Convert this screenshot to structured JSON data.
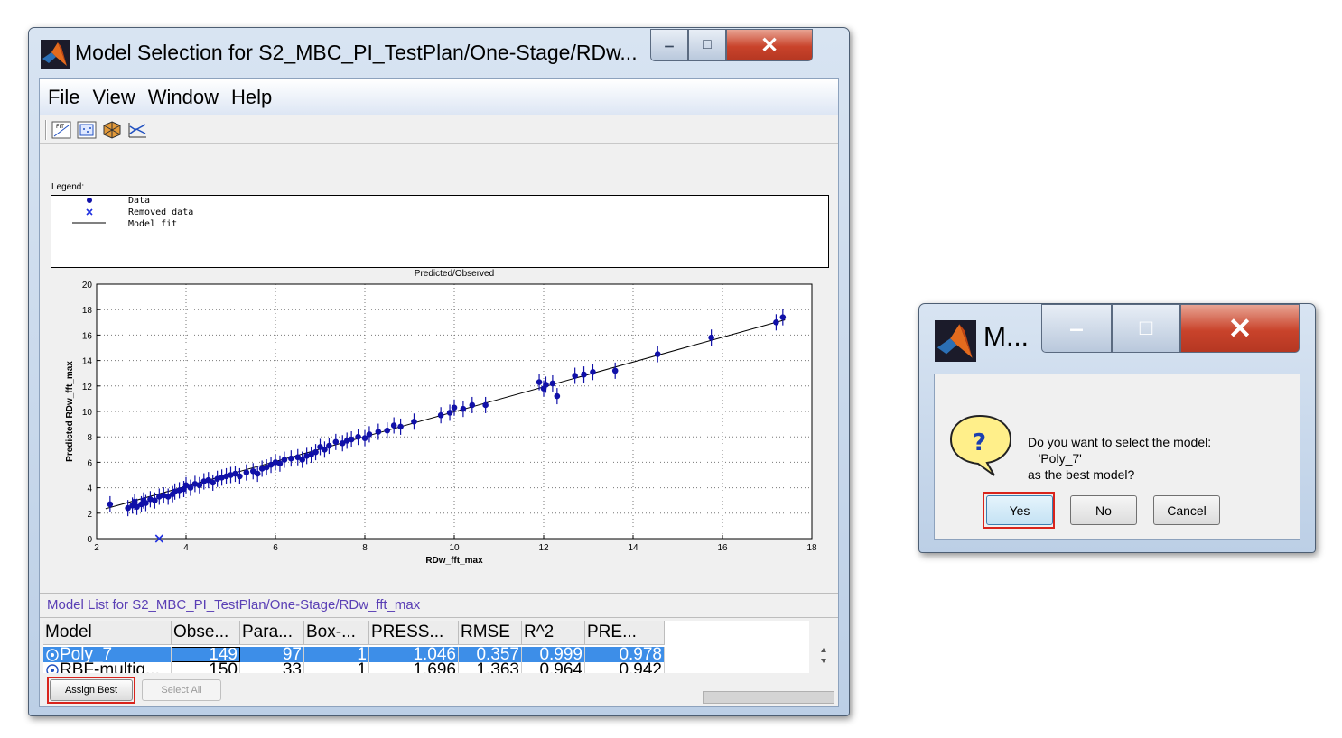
{
  "main_window": {
    "title": "Model Selection for S2_MBC_PI_TestPlan/One-Stage/RDw...",
    "menu": [
      "File",
      "View",
      "Window",
      "Help"
    ],
    "toolbar_icons": [
      "fit-plot-icon",
      "residual-plot-icon",
      "cube-3d-icon",
      "cross-section-plot-icon"
    ],
    "legend": {
      "label": "Legend:",
      "entries": [
        "Data",
        "Removed data",
        "Model fit"
      ]
    },
    "model_list_title": "Model List for S2_MBC_PI_TestPlan/One-Stage/RDw_fft_max",
    "table": {
      "columns": [
        "Model",
        "Obse...",
        "Para...",
        "Box-...",
        "PRESS...",
        "RMSE",
        "R^2",
        "PRE..."
      ],
      "rows": [
        [
          "Poly_7",
          "149",
          "97",
          "1",
          "1.046",
          "0.357",
          "0.999",
          "0.978"
        ],
        [
          "RBF-multiq...",
          "150",
          "33",
          "1",
          "1.696",
          "1.363",
          "0.964",
          "0.942"
        ]
      ],
      "selected_row": 0
    },
    "buttons": {
      "assign_best": "Assign Best",
      "select_all": "Select All"
    }
  },
  "dialog": {
    "title": "M...",
    "icon": "question-icon",
    "message": [
      "Do you want to select the model:",
      "   'Poly_7'",
      "as the best model?"
    ],
    "buttons": {
      "yes": "Yes",
      "no": "No",
      "cancel": "Cancel"
    }
  },
  "colors": {
    "data_marker": "#1010a8",
    "removed_marker": "#2030e0",
    "highlight": "#d9241c",
    "selection": "#3d8ee8",
    "model_list_title": "#5a3fb5"
  },
  "chart_data": {
    "type": "scatter",
    "title": "Predicted/Observed",
    "xlabel": "RDw_fft_max",
    "ylabel": "Predicted RDw_fft_max",
    "xlim": [
      2,
      18
    ],
    "ylim": [
      0,
      20
    ],
    "xticks": [
      2,
      4,
      6,
      8,
      10,
      12,
      14,
      16,
      18
    ],
    "yticks": [
      0,
      2,
      4,
      6,
      8,
      10,
      12,
      14,
      16,
      18,
      20
    ],
    "grid": true,
    "model_fit_line": [
      [
        2.2,
        2.35
      ],
      [
        17.4,
        17.2
      ]
    ],
    "series": [
      {
        "name": "Data",
        "marker": "filled-circle",
        "points": [
          [
            2.3,
            2.7
          ],
          [
            2.7,
            2.4
          ],
          [
            2.8,
            2.6
          ],
          [
            2.85,
            2.9
          ],
          [
            2.9,
            2.5
          ],
          [
            3.0,
            2.7
          ],
          [
            3.05,
            3.0
          ],
          [
            3.1,
            2.8
          ],
          [
            3.2,
            3.1
          ],
          [
            3.3,
            3.0
          ],
          [
            3.4,
            3.3
          ],
          [
            3.5,
            3.4
          ],
          [
            3.6,
            3.3
          ],
          [
            3.7,
            3.5
          ],
          [
            3.75,
            3.7
          ],
          [
            3.85,
            3.8
          ],
          [
            3.95,
            3.9
          ],
          [
            4.0,
            4.2
          ],
          [
            4.1,
            4.0
          ],
          [
            4.2,
            4.3
          ],
          [
            4.3,
            4.2
          ],
          [
            4.4,
            4.5
          ],
          [
            4.5,
            4.6
          ],
          [
            4.6,
            4.4
          ],
          [
            4.7,
            4.7
          ],
          [
            4.8,
            4.8
          ],
          [
            4.9,
            4.9
          ],
          [
            5.0,
            5.0
          ],
          [
            5.1,
            5.1
          ],
          [
            5.2,
            4.9
          ],
          [
            5.35,
            5.2
          ],
          [
            5.5,
            5.3
          ],
          [
            5.6,
            5.1
          ],
          [
            5.7,
            5.5
          ],
          [
            5.8,
            5.6
          ],
          [
            5.9,
            5.8
          ],
          [
            6.0,
            6.0
          ],
          [
            6.1,
            5.9
          ],
          [
            6.2,
            6.2
          ],
          [
            6.35,
            6.3
          ],
          [
            6.5,
            6.4
          ],
          [
            6.6,
            6.2
          ],
          [
            6.7,
            6.5
          ],
          [
            6.8,
            6.6
          ],
          [
            6.9,
            6.8
          ],
          [
            7.0,
            7.2
          ],
          [
            7.1,
            7.0
          ],
          [
            7.2,
            7.3
          ],
          [
            7.35,
            7.6
          ],
          [
            7.5,
            7.5
          ],
          [
            7.6,
            7.7
          ],
          [
            7.7,
            7.8
          ],
          [
            7.85,
            8.0
          ],
          [
            8.0,
            7.9
          ],
          [
            8.1,
            8.2
          ],
          [
            8.3,
            8.4
          ],
          [
            8.5,
            8.5
          ],
          [
            8.65,
            8.9
          ],
          [
            8.8,
            8.8
          ],
          [
            9.1,
            9.2
          ],
          [
            9.7,
            9.7
          ],
          [
            9.9,
            9.9
          ],
          [
            10.0,
            10.3
          ],
          [
            10.2,
            10.2
          ],
          [
            10.4,
            10.5
          ],
          [
            10.7,
            10.5
          ],
          [
            11.9,
            12.3
          ],
          [
            12.0,
            11.8
          ],
          [
            12.05,
            12.1
          ],
          [
            12.2,
            12.2
          ],
          [
            12.3,
            11.2
          ],
          [
            12.7,
            12.8
          ],
          [
            12.9,
            12.9
          ],
          [
            13.1,
            13.1
          ],
          [
            13.6,
            13.2
          ],
          [
            14.55,
            14.5
          ],
          [
            15.75,
            15.8
          ],
          [
            17.2,
            17.0
          ],
          [
            17.35,
            17.4
          ]
        ]
      },
      {
        "name": "Removed data",
        "marker": "x",
        "points": [
          [
            3.4,
            0.0
          ]
        ]
      }
    ]
  }
}
